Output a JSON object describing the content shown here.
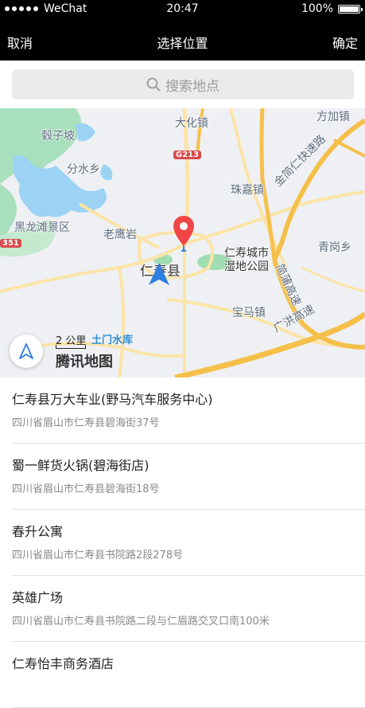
{
  "status_bar": {
    "carrier": "WeChat",
    "time": "20:47",
    "battery": "100%",
    "signal_dots": 5
  },
  "nav": {
    "cancel": "取消",
    "title": "选择位置",
    "confirm": "确定"
  },
  "search": {
    "placeholder": "搜索地点"
  },
  "map": {
    "labels": {
      "daohuazhen": "大化镇",
      "fangjiazhen": "方加镇",
      "guizibo": "毂子坡",
      "fenshuixiang": "分水乡",
      "zhujiazhen": "珠嘉镇",
      "heilongtan": "黑龙滩景区",
      "laoyingyan": "老鹰岩",
      "renshouxian": "仁寿县",
      "wetland": "仁寿城市湿地公园",
      "qinggangxiang": "青岗乡",
      "baomazhen": "宝马镇",
      "expressway1": "金简仁快速路",
      "expressway2": "简蒲高速",
      "expressway3": "广洪高速",
      "tumenshuiku": "土门水库",
      "g213": "G213",
      "s351": "351"
    },
    "scale_label": "2 公里",
    "brand": "腾讯地图",
    "colors": {
      "water": "#9cd3f5",
      "green": "#9fdcb0",
      "road_major": "#f5c04a",
      "road_minor": "#fbe4a6",
      "pin": "#f04646",
      "arrow": "#2f7fe0"
    }
  },
  "places": [
    {
      "name": "仁寿县万大车业(野马汽车服务中心)",
      "address": "四川省眉山市仁寿县碧海街37号"
    },
    {
      "name": "蜀一鲜货火锅(碧海街店)",
      "address": "四川省眉山市仁寿县碧海街18号"
    },
    {
      "name": "春升公寓",
      "address": "四川省眉山市仁寿县书院路2段278号"
    },
    {
      "name": "英雄广场",
      "address": "四川省眉山市仁寿县书院路二段与仁眉路交叉口南100米"
    },
    {
      "name": "仁寿怡丰商务酒店",
      "address": ""
    }
  ]
}
